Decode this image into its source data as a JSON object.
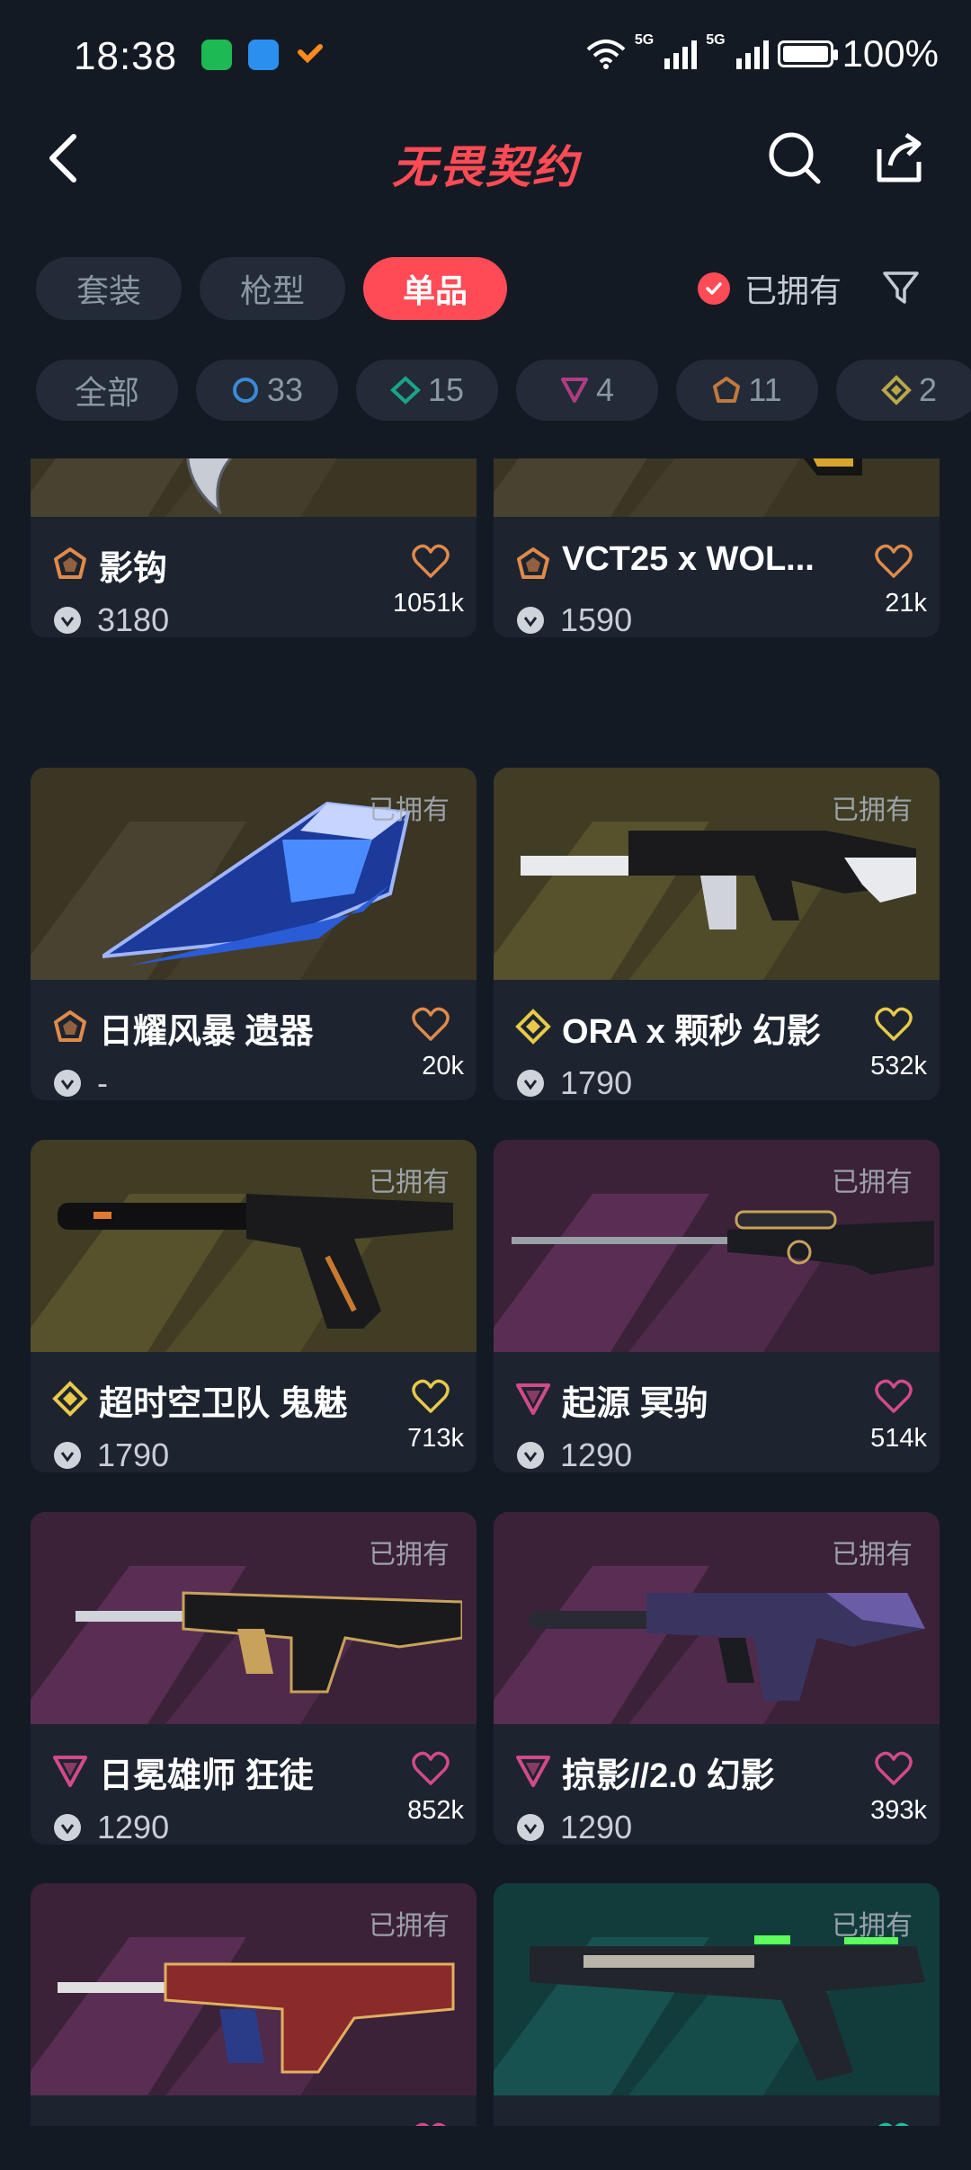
{
  "status_bar": {
    "time": "18:38",
    "battery_pct": "100%",
    "net1": "5G",
    "net2": "5G"
  },
  "header": {
    "title": "无畏契约"
  },
  "tabs": [
    {
      "label": "套装",
      "active": false
    },
    {
      "label": "枪型",
      "active": false
    },
    {
      "label": "单品",
      "active": true
    }
  ],
  "owned_filter": {
    "label": "已拥有",
    "checked": true
  },
  "tier_filters": [
    {
      "label": "全部",
      "tier": "all"
    },
    {
      "label": "33",
      "tier": "select"
    },
    {
      "label": "15",
      "tier": "deluxe"
    },
    {
      "label": "4",
      "tier": "premium"
    },
    {
      "label": "11",
      "tier": "exclusive"
    },
    {
      "label": "2",
      "tier": "ultra"
    }
  ],
  "colors": {
    "accent": "#ff4b55",
    "bg": "#141a24",
    "card": "#1d2430",
    "exclusive": "#e08a4a",
    "ultra": "#e8c94a",
    "premium": "#d24a8a"
  },
  "items": [
    {
      "name": "影钩",
      "price": "3180",
      "likes": "1051k",
      "tier": "exclusive",
      "owned": "",
      "bg": "olive",
      "weapon": "knife-hook"
    },
    {
      "name": "VCT25 x WOL...",
      "price": "1590",
      "likes": "21k",
      "tier": "exclusive",
      "owned": "",
      "bg": "olive",
      "weapon": "pistol-gold"
    },
    {
      "name": "日耀风暴 遗器",
      "price": "-",
      "likes": "20k",
      "tier": "exclusive",
      "owned": "已拥有",
      "bg": "olive",
      "weapon": "crystal-blade"
    },
    {
      "name": "ORA x 颗秒 幻影",
      "price": "1790",
      "likes": "532k",
      "tier": "ultra",
      "owned": "已拥有",
      "bg": "yellow",
      "weapon": "rifle-white"
    },
    {
      "name": "超时空卫队 鬼魅",
      "price": "1790",
      "likes": "713k",
      "tier": "ultra",
      "owned": "已拥有",
      "bg": "yellow",
      "weapon": "pistol-suppressed"
    },
    {
      "name": "起源 冥驹",
      "price": "1290",
      "likes": "514k",
      "tier": "premium",
      "owned": "已拥有",
      "bg": "purple",
      "weapon": "sniper"
    },
    {
      "name": "日冕雄师 狂徒",
      "price": "1290",
      "likes": "852k",
      "tier": "premium",
      "owned": "已拥有",
      "bg": "purple",
      "weapon": "rifle-gold"
    },
    {
      "name": "掠影//2.0 幻影",
      "price": "1290",
      "likes": "393k",
      "tier": "premium",
      "owned": "已拥有",
      "bg": "purple",
      "weapon": "rifle-violet"
    },
    {
      "name": "",
      "price": "",
      "likes": "",
      "tier": "premium",
      "owned": "已拥有",
      "bg": "purple",
      "weapon": "rifle-red"
    },
    {
      "name": "",
      "price": "",
      "likes": "",
      "tier": "select",
      "owned": "已拥有",
      "bg": "teal",
      "weapon": "pistol-green"
    }
  ]
}
